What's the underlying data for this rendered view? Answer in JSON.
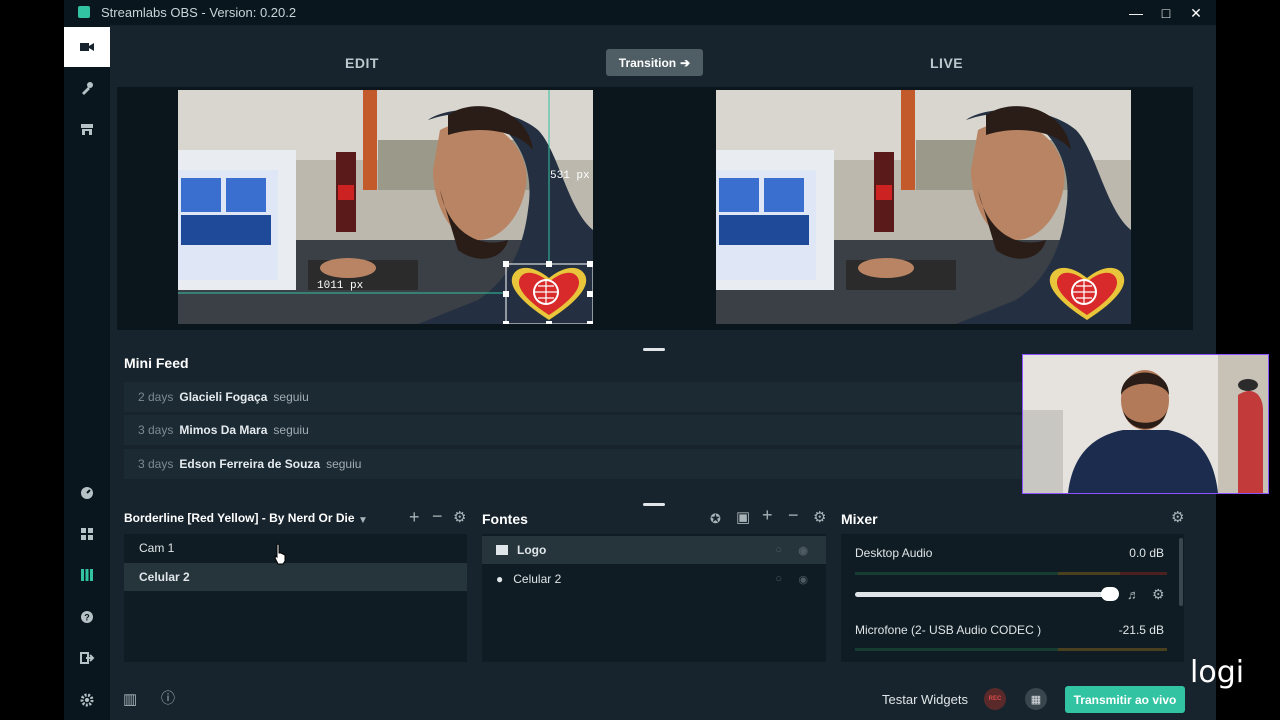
{
  "window": {
    "title": "Streamlabs OBS - Version: 0.20.2"
  },
  "studio": {
    "edit_label": "EDIT",
    "live_label": "LIVE",
    "transition_label": "Transition",
    "measure_width": "1011 px",
    "measure_height": "531 px"
  },
  "mini_feed": {
    "title": "Mini Feed",
    "events": [
      {
        "age": "2 days",
        "name": "Glacieli Fogaça",
        "action": "seguiu"
      },
      {
        "age": "3 days",
        "name": "Mimos Da Mara",
        "action": "seguiu"
      },
      {
        "age": "3 days",
        "name": "Edson Ferreira de Souza",
        "action": "seguiu"
      }
    ]
  },
  "scenes": {
    "collection_name": "Borderline [Red Yellow] - By Nerd Or Die",
    "items": [
      {
        "label": "Cam 1"
      },
      {
        "label": "Celular 2"
      }
    ]
  },
  "sources": {
    "title": "Fontes",
    "items": [
      {
        "label": "Logo",
        "icon": "image-icon"
      },
      {
        "label": "Celular 2",
        "icon": "globe-icon"
      }
    ]
  },
  "mixer": {
    "title": "Mixer",
    "channels": [
      {
        "name": "Desktop Audio",
        "value": "0.0 dB",
        "level": 0.95
      },
      {
        "name": "Microfone (2- USB Audio CODEC )",
        "value": "-21.5 dB"
      }
    ]
  },
  "footer": {
    "test_widgets": "Testar Widgets",
    "rec_label": "REC",
    "go_live": "Transmitir ao vivo"
  },
  "overlay": {
    "webcam_badge": "logi"
  },
  "colors": {
    "accent": "#31c3a2",
    "background": "#17242d",
    "rec": "#d64a4a"
  }
}
